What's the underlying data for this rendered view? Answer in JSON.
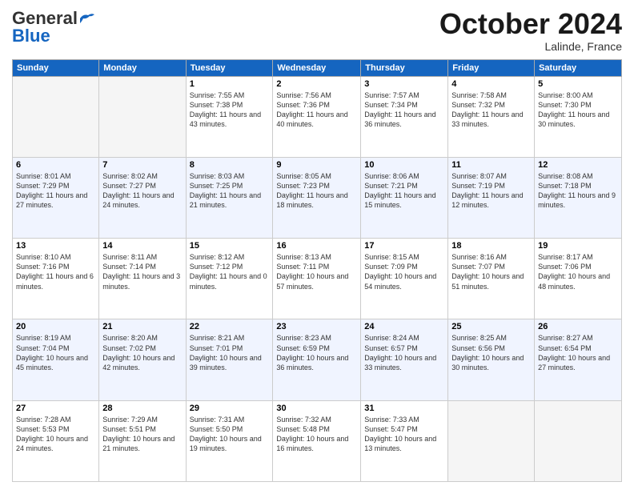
{
  "logo": {
    "general": "General",
    "blue": "Blue"
  },
  "header": {
    "month": "October 2024",
    "location": "Lalinde, France"
  },
  "days_of_week": [
    "Sunday",
    "Monday",
    "Tuesday",
    "Wednesday",
    "Thursday",
    "Friday",
    "Saturday"
  ],
  "weeks": [
    [
      {
        "day": "",
        "empty": true
      },
      {
        "day": "",
        "empty": true
      },
      {
        "day": "1",
        "sunrise": "Sunrise: 7:55 AM",
        "sunset": "Sunset: 7:38 PM",
        "daylight": "Daylight: 11 hours and 43 minutes."
      },
      {
        "day": "2",
        "sunrise": "Sunrise: 7:56 AM",
        "sunset": "Sunset: 7:36 PM",
        "daylight": "Daylight: 11 hours and 40 minutes."
      },
      {
        "day": "3",
        "sunrise": "Sunrise: 7:57 AM",
        "sunset": "Sunset: 7:34 PM",
        "daylight": "Daylight: 11 hours and 36 minutes."
      },
      {
        "day": "4",
        "sunrise": "Sunrise: 7:58 AM",
        "sunset": "Sunset: 7:32 PM",
        "daylight": "Daylight: 11 hours and 33 minutes."
      },
      {
        "day": "5",
        "sunrise": "Sunrise: 8:00 AM",
        "sunset": "Sunset: 7:30 PM",
        "daylight": "Daylight: 11 hours and 30 minutes."
      }
    ],
    [
      {
        "day": "6",
        "sunrise": "Sunrise: 8:01 AM",
        "sunset": "Sunset: 7:29 PM",
        "daylight": "Daylight: 11 hours and 27 minutes."
      },
      {
        "day": "7",
        "sunrise": "Sunrise: 8:02 AM",
        "sunset": "Sunset: 7:27 PM",
        "daylight": "Daylight: 11 hours and 24 minutes."
      },
      {
        "day": "8",
        "sunrise": "Sunrise: 8:03 AM",
        "sunset": "Sunset: 7:25 PM",
        "daylight": "Daylight: 11 hours and 21 minutes."
      },
      {
        "day": "9",
        "sunrise": "Sunrise: 8:05 AM",
        "sunset": "Sunset: 7:23 PM",
        "daylight": "Daylight: 11 hours and 18 minutes."
      },
      {
        "day": "10",
        "sunrise": "Sunrise: 8:06 AM",
        "sunset": "Sunset: 7:21 PM",
        "daylight": "Daylight: 11 hours and 15 minutes."
      },
      {
        "day": "11",
        "sunrise": "Sunrise: 8:07 AM",
        "sunset": "Sunset: 7:19 PM",
        "daylight": "Daylight: 11 hours and 12 minutes."
      },
      {
        "day": "12",
        "sunrise": "Sunrise: 8:08 AM",
        "sunset": "Sunset: 7:18 PM",
        "daylight": "Daylight: 11 hours and 9 minutes."
      }
    ],
    [
      {
        "day": "13",
        "sunrise": "Sunrise: 8:10 AM",
        "sunset": "Sunset: 7:16 PM",
        "daylight": "Daylight: 11 hours and 6 minutes."
      },
      {
        "day": "14",
        "sunrise": "Sunrise: 8:11 AM",
        "sunset": "Sunset: 7:14 PM",
        "daylight": "Daylight: 11 hours and 3 minutes."
      },
      {
        "day": "15",
        "sunrise": "Sunrise: 8:12 AM",
        "sunset": "Sunset: 7:12 PM",
        "daylight": "Daylight: 11 hours and 0 minutes."
      },
      {
        "day": "16",
        "sunrise": "Sunrise: 8:13 AM",
        "sunset": "Sunset: 7:11 PM",
        "daylight": "Daylight: 10 hours and 57 minutes."
      },
      {
        "day": "17",
        "sunrise": "Sunrise: 8:15 AM",
        "sunset": "Sunset: 7:09 PM",
        "daylight": "Daylight: 10 hours and 54 minutes."
      },
      {
        "day": "18",
        "sunrise": "Sunrise: 8:16 AM",
        "sunset": "Sunset: 7:07 PM",
        "daylight": "Daylight: 10 hours and 51 minutes."
      },
      {
        "day": "19",
        "sunrise": "Sunrise: 8:17 AM",
        "sunset": "Sunset: 7:06 PM",
        "daylight": "Daylight: 10 hours and 48 minutes."
      }
    ],
    [
      {
        "day": "20",
        "sunrise": "Sunrise: 8:19 AM",
        "sunset": "Sunset: 7:04 PM",
        "daylight": "Daylight: 10 hours and 45 minutes."
      },
      {
        "day": "21",
        "sunrise": "Sunrise: 8:20 AM",
        "sunset": "Sunset: 7:02 PM",
        "daylight": "Daylight: 10 hours and 42 minutes."
      },
      {
        "day": "22",
        "sunrise": "Sunrise: 8:21 AM",
        "sunset": "Sunset: 7:01 PM",
        "daylight": "Daylight: 10 hours and 39 minutes."
      },
      {
        "day": "23",
        "sunrise": "Sunrise: 8:23 AM",
        "sunset": "Sunset: 6:59 PM",
        "daylight": "Daylight: 10 hours and 36 minutes."
      },
      {
        "day": "24",
        "sunrise": "Sunrise: 8:24 AM",
        "sunset": "Sunset: 6:57 PM",
        "daylight": "Daylight: 10 hours and 33 minutes."
      },
      {
        "day": "25",
        "sunrise": "Sunrise: 8:25 AM",
        "sunset": "Sunset: 6:56 PM",
        "daylight": "Daylight: 10 hours and 30 minutes."
      },
      {
        "day": "26",
        "sunrise": "Sunrise: 8:27 AM",
        "sunset": "Sunset: 6:54 PM",
        "daylight": "Daylight: 10 hours and 27 minutes."
      }
    ],
    [
      {
        "day": "27",
        "sunrise": "Sunrise: 7:28 AM",
        "sunset": "Sunset: 5:53 PM",
        "daylight": "Daylight: 10 hours and 24 minutes."
      },
      {
        "day": "28",
        "sunrise": "Sunrise: 7:29 AM",
        "sunset": "Sunset: 5:51 PM",
        "daylight": "Daylight: 10 hours and 21 minutes."
      },
      {
        "day": "29",
        "sunrise": "Sunrise: 7:31 AM",
        "sunset": "Sunset: 5:50 PM",
        "daylight": "Daylight: 10 hours and 19 minutes."
      },
      {
        "day": "30",
        "sunrise": "Sunrise: 7:32 AM",
        "sunset": "Sunset: 5:48 PM",
        "daylight": "Daylight: 10 hours and 16 minutes."
      },
      {
        "day": "31",
        "sunrise": "Sunrise: 7:33 AM",
        "sunset": "Sunset: 5:47 PM",
        "daylight": "Daylight: 10 hours and 13 minutes."
      },
      {
        "day": "",
        "empty": true
      },
      {
        "day": "",
        "empty": true
      }
    ]
  ]
}
